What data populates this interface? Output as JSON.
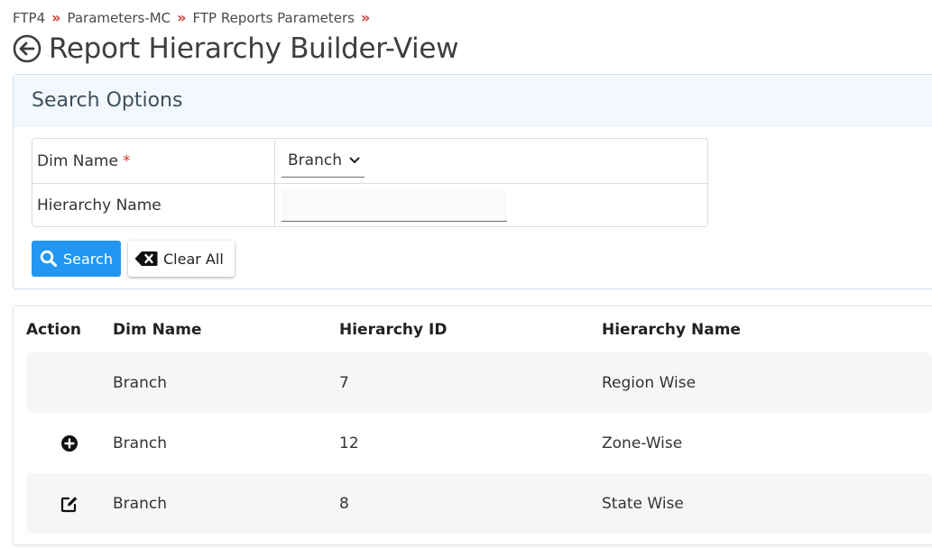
{
  "breadcrumb": {
    "items": [
      "FTP4",
      "Parameters-MC",
      "FTP Reports Parameters"
    ],
    "separator": "»"
  },
  "page": {
    "title": "Report Hierarchy Builder-View",
    "back_icon": "circle-arrow-left-icon"
  },
  "search_options": {
    "title": "Search Options",
    "fields": {
      "dim_name": {
        "label": "Dim Name",
        "required_mark": "*",
        "value": "Branch"
      },
      "hierarchy_name": {
        "label": "Hierarchy Name",
        "value": "",
        "placeholder": ""
      }
    },
    "buttons": {
      "search": "Search",
      "clear": "Clear All"
    }
  },
  "results": {
    "columns": [
      "Action",
      "Dim Name",
      "Hierarchy ID",
      "Hierarchy Name"
    ],
    "rows": [
      {
        "action_icon": "",
        "dim_name": "Branch",
        "hierarchy_id": "7",
        "hierarchy_name": "Region Wise"
      },
      {
        "action_icon": "plus-circle-icon",
        "dim_name": "Branch",
        "hierarchy_id": "12",
        "hierarchy_name": "Zone-Wise"
      },
      {
        "action_icon": "edit-icon",
        "dim_name": "Branch",
        "hierarchy_id": "8",
        "hierarchy_name": "State Wise"
      }
    ]
  },
  "colors": {
    "accent": "#2196f3",
    "separator": "#d9362b",
    "panel_header_bg": "#f2f8fd"
  }
}
